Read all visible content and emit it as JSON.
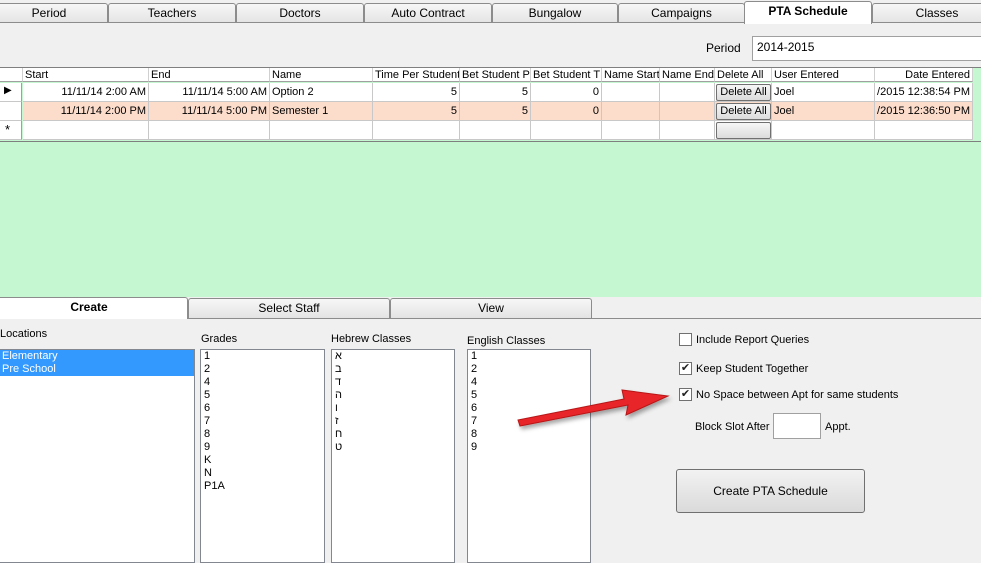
{
  "top_tabs": [
    "Period",
    "Teachers",
    "Doctors",
    "Auto Contract",
    "Bungalow",
    "Campaigns",
    "PTA Schedule",
    "Classes"
  ],
  "active_top_tab": "PTA Schedule",
  "period": {
    "label": "Period",
    "value": "2014-2015"
  },
  "grid": {
    "columns": [
      "Start",
      "End",
      "Name",
      "Time Per Student",
      "Bet Student P",
      "Bet Student T",
      "Name Start",
      "Name End",
      "Delete All",
      "User Entered",
      "Date Entered"
    ],
    "rows": [
      {
        "start": "11/11/14 2:00 AM",
        "end": "11/11/14 5:00 AM",
        "name": "Option 2",
        "time_per_student": "5",
        "bet_student_p": "5",
        "bet_student_t": "0",
        "name_start": "",
        "name_end": "",
        "delete_label": "Delete All",
        "user_entered": "Joel",
        "date_entered": "/2015 12:38:54 PM"
      },
      {
        "start": "11/11/14 2:00 PM",
        "end": "11/11/14 5:00 PM",
        "name": "Semester 1",
        "time_per_student": "5",
        "bet_student_p": "5",
        "bet_student_t": "0",
        "name_start": "",
        "name_end": "",
        "delete_label": "Delete All",
        "user_entered": "Joel",
        "date_entered": "/2015 12:36:50 PM"
      }
    ],
    "new_row_marker": "*",
    "current_row_marker": "▶",
    "selected_row_color": "#fcdccb",
    "background_color": "#c5f8d0"
  },
  "bottom_tabs": [
    "Create",
    "Select Staff",
    "View"
  ],
  "active_bottom_tab": "Create",
  "locations": {
    "label": "Locations",
    "items": [
      "Elementary",
      "Pre School"
    ]
  },
  "grades": {
    "label": "Grades",
    "items": [
      "1",
      "2",
      "4",
      "5",
      "6",
      "7",
      "8",
      "9",
      "K",
      "N",
      "P1A"
    ]
  },
  "hebrew_classes": {
    "label": "Hebrew Classes",
    "items": [
      "א",
      "ב",
      "ד",
      "ה",
      "ו",
      "ז",
      "ח",
      "ט"
    ]
  },
  "english_classes": {
    "label": "English Classes",
    "items": [
      "1",
      "2",
      "4",
      "5",
      "6",
      "7",
      "8",
      "9"
    ]
  },
  "options": {
    "include_report_queries": {
      "label": "Include Report Queries",
      "checked": false
    },
    "keep_student_together": {
      "label": "Keep Student Together",
      "checked": true
    },
    "no_space_between": {
      "label": "No Space between Apt for same students",
      "checked": true
    }
  },
  "block_slot": {
    "label": "Block Slot After",
    "value": "",
    "suffix": "Appt."
  },
  "create_button_label": "Create PTA Schedule",
  "arrow_color": "#e8262a"
}
